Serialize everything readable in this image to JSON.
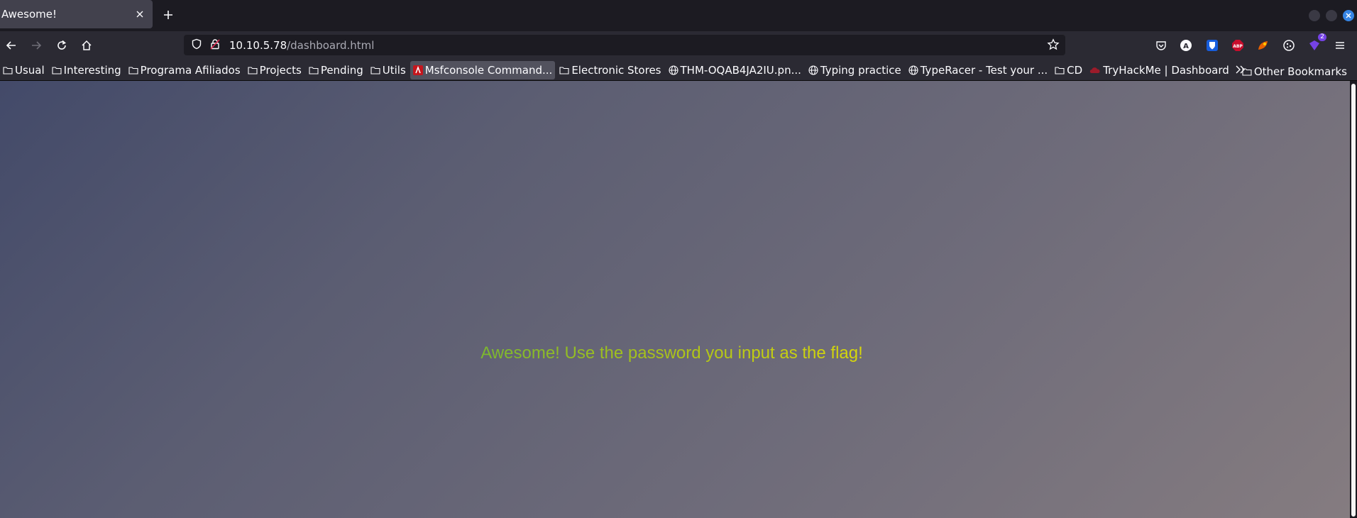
{
  "tab": {
    "title": "Awesome!",
    "close_glyph": "✕",
    "new_tab_glyph": "+"
  },
  "navbar": {
    "url_host": "10.10.5.78",
    "url_path": "/dashboard.html",
    "extension_badge": "2"
  },
  "bookmarks": {
    "items": [
      {
        "label": "Usual",
        "icon": "folder-icon"
      },
      {
        "label": "Interesting",
        "icon": "folder-icon"
      },
      {
        "label": "Programa Afiliados",
        "icon": "folder-icon"
      },
      {
        "label": "Projects",
        "icon": "folder-icon"
      },
      {
        "label": "Pending",
        "icon": "folder-icon"
      },
      {
        "label": "Utils",
        "icon": "folder-icon"
      },
      {
        "label": "Msfconsole Command...",
        "icon": "site-favicon-icon"
      },
      {
        "label": "Electronic Stores",
        "icon": "folder-icon"
      },
      {
        "label": "THM-OQAB4JA2IU.pn...",
        "icon": "globe-icon"
      },
      {
        "label": "Typing practice",
        "icon": "globe-icon"
      },
      {
        "label": "TypeRacer - Test your ...",
        "icon": "globe-icon"
      },
      {
        "label": "CD",
        "icon": "folder-icon"
      },
      {
        "label": "TryHackMe | Dashboard",
        "icon": "tryhackme-icon"
      }
    ],
    "other_label": "Other Bookmarks"
  },
  "page": {
    "message": "Awesome! Use the password you input as the flag!"
  },
  "colors": {
    "message_start": "#7cb82f",
    "message_end": "#d8d80a",
    "background_start": "#434a69",
    "background_end": "#857c80"
  }
}
